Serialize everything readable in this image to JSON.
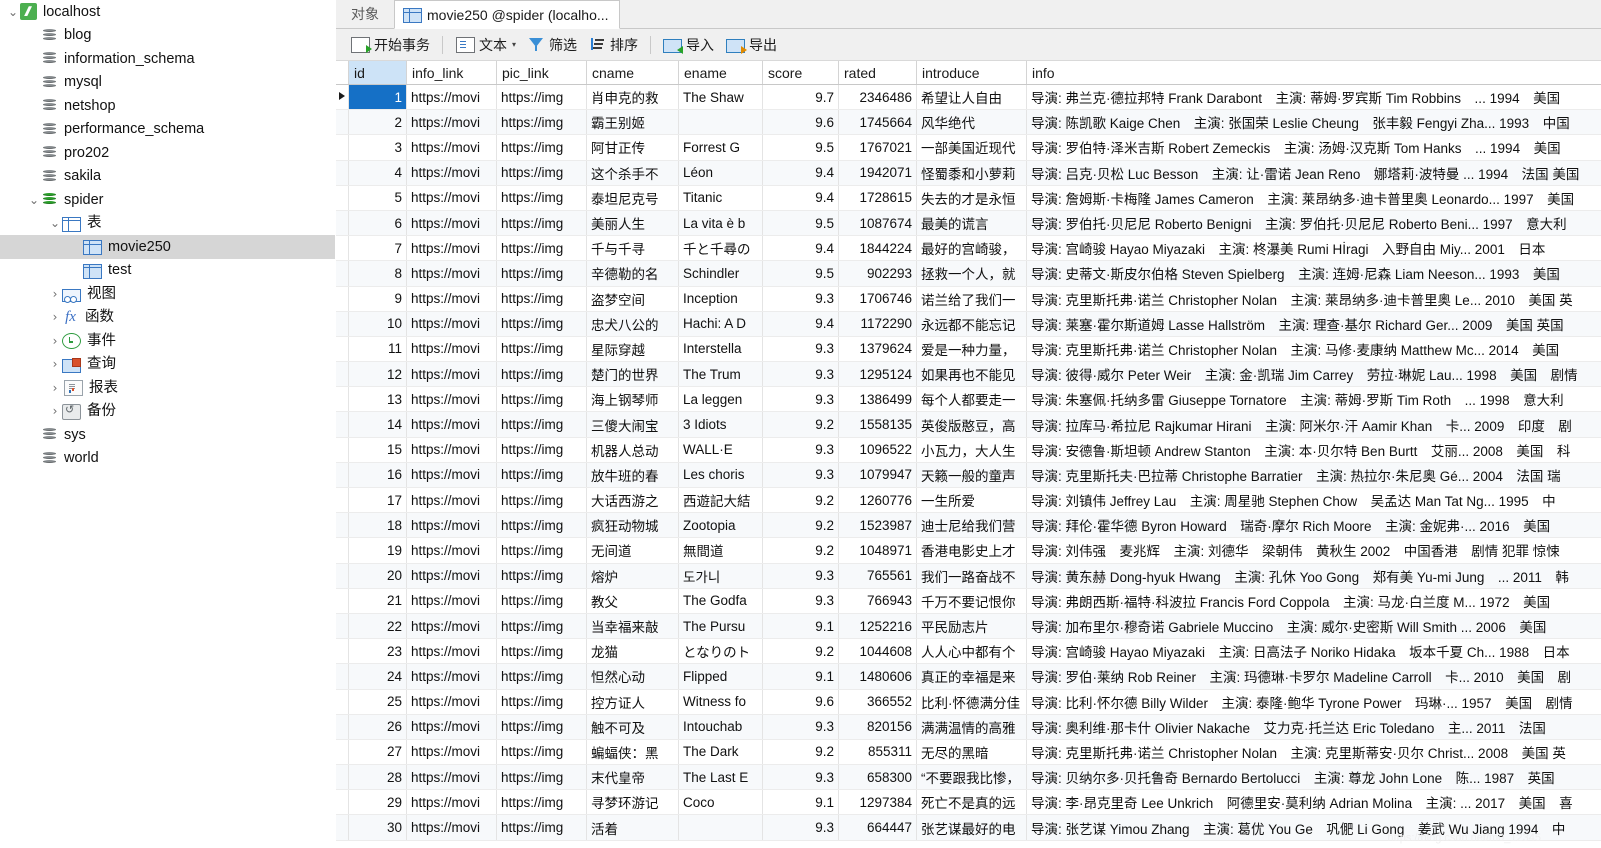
{
  "sidebar": {
    "items": [
      {
        "label": "localhost",
        "icon": "host-icon",
        "indent": 0,
        "twisty": "⌄",
        "selected": false
      },
      {
        "label": "blog",
        "icon": "database-icon",
        "indent": 1,
        "twisty": "",
        "selected": false
      },
      {
        "label": "information_schema",
        "icon": "database-icon",
        "indent": 1,
        "twisty": "",
        "selected": false
      },
      {
        "label": "mysql",
        "icon": "database-icon",
        "indent": 1,
        "twisty": "",
        "selected": false
      },
      {
        "label": "netshop",
        "icon": "database-icon",
        "indent": 1,
        "twisty": "",
        "selected": false
      },
      {
        "label": "performance_schema",
        "icon": "database-icon",
        "indent": 1,
        "twisty": "",
        "selected": false
      },
      {
        "label": "pro202",
        "icon": "database-icon",
        "indent": 1,
        "twisty": "",
        "selected": false
      },
      {
        "label": "sakila",
        "icon": "database-icon",
        "indent": 1,
        "twisty": "",
        "selected": false
      },
      {
        "label": "spider",
        "icon": "database-icon-green",
        "indent": 1,
        "twisty": "⌄",
        "selected": false
      },
      {
        "label": "表",
        "icon": "table-icon",
        "indent": 2,
        "twisty": "⌄",
        "selected": false
      },
      {
        "label": "movie250",
        "icon": "table-icon-filled",
        "indent": 3,
        "twisty": "",
        "selected": true
      },
      {
        "label": "test",
        "icon": "table-icon-filled",
        "indent": 3,
        "twisty": "",
        "selected": false
      },
      {
        "label": "视图",
        "icon": "view-icon",
        "indent": 2,
        "twisty": "›",
        "selected": false
      },
      {
        "label": "函数",
        "icon": "function-icon",
        "indent": 2,
        "twisty": "›",
        "selected": false
      },
      {
        "label": "事件",
        "icon": "event-clock-icon",
        "indent": 2,
        "twisty": "›",
        "selected": false
      },
      {
        "label": "查询",
        "icon": "query-icon",
        "indent": 2,
        "twisty": "›",
        "selected": false
      },
      {
        "label": "报表",
        "icon": "report-icon",
        "indent": 2,
        "twisty": "›",
        "selected": false
      },
      {
        "label": "备份",
        "icon": "backup-icon",
        "indent": 2,
        "twisty": "›",
        "selected": false
      },
      {
        "label": "sys",
        "icon": "database-icon",
        "indent": 1,
        "twisty": "",
        "selected": false
      },
      {
        "label": "world",
        "icon": "database-icon",
        "indent": 1,
        "twisty": "",
        "selected": false
      }
    ]
  },
  "tabs": [
    {
      "label": "对象",
      "icon": "",
      "active": false
    },
    {
      "label": "movie250 @spider (localho...",
      "icon": "table-icon",
      "active": true
    }
  ],
  "toolbar": {
    "begin_transaction": "开始事务",
    "text": "文本",
    "text_caret": "▾",
    "filter": "筛选",
    "sort": "排序",
    "import": "导入",
    "export": "导出"
  },
  "grid": {
    "columns": [
      {
        "key": "id",
        "label": "id",
        "selected": true
      },
      {
        "key": "info_link",
        "label": "info_link",
        "selected": false
      },
      {
        "key": "pic_link",
        "label": "pic_link",
        "selected": false
      },
      {
        "key": "cname",
        "label": "cname",
        "selected": false
      },
      {
        "key": "ename",
        "label": "ename",
        "selected": false
      },
      {
        "key": "score",
        "label": "score",
        "selected": false
      },
      {
        "key": "rated",
        "label": "rated",
        "selected": false
      },
      {
        "key": "introduce",
        "label": "introduce",
        "selected": false
      },
      {
        "key": "info",
        "label": "info",
        "selected": false
      }
    ],
    "current_row": 1,
    "rows": [
      {
        "id": "1",
        "info_link": "https://movi",
        "pic_link": "https://img",
        "cname": "肖申克的救",
        "ename": "The Shaw",
        "score": "9.7",
        "rated": "2346486",
        "introduce": "希望让人自由",
        "info": "导演: 弗兰克·德拉邦特 Frank Darabont　主演: 蒂姆·罗宾斯 Tim Robbins　... 1994　美国"
      },
      {
        "id": "2",
        "info_link": "https://movi",
        "pic_link": "https://img",
        "cname": "霸王别姬",
        "ename": "",
        "score": "9.6",
        "rated": "1745664",
        "introduce": "风华绝代",
        "info": "导演: 陈凯歌 Kaige Chen　主演: 张国荣 Leslie Cheung　张丰毅 Fengyi Zha... 1993　中国"
      },
      {
        "id": "3",
        "info_link": "https://movi",
        "pic_link": "https://img",
        "cname": "阿甘正传",
        "ename": "Forrest G",
        "score": "9.5",
        "rated": "1767021",
        "introduce": "一部美国近现代",
        "info": "导演: 罗伯特·泽米吉斯 Robert Zemeckis　主演: 汤姆·汉克斯 Tom Hanks　... 1994　美国"
      },
      {
        "id": "4",
        "info_link": "https://movi",
        "pic_link": "https://img",
        "cname": "这个杀手不",
        "ename": "Léon",
        "score": "9.4",
        "rated": "1942071",
        "introduce": "怪蜀黍和小萝莉",
        "info": "导演: 吕克·贝松 Luc Besson　主演: 让·雷诺 Jean Reno　娜塔莉·波特曼 ... 1994　法国 美国"
      },
      {
        "id": "5",
        "info_link": "https://movi",
        "pic_link": "https://img",
        "cname": "泰坦尼克号",
        "ename": "Titanic",
        "score": "9.4",
        "rated": "1728615",
        "introduce": "失去的才是永恒",
        "info": "导演: 詹姆斯·卡梅隆 James Cameron　主演: 莱昂纳多·迪卡普里奥 Leonardo... 1997　美国"
      },
      {
        "id": "6",
        "info_link": "https://movi",
        "pic_link": "https://img",
        "cname": "美丽人生",
        "ename": "La vita è b",
        "score": "9.5",
        "rated": "1087674",
        "introduce": "最美的谎言",
        "info": "导演: 罗伯托·贝尼尼 Roberto Benigni　主演: 罗伯托·贝尼尼 Roberto Beni... 1997　意大利"
      },
      {
        "id": "7",
        "info_link": "https://movi",
        "pic_link": "https://img",
        "cname": "千与千寻",
        "ename": "千と千尋の",
        "score": "9.4",
        "rated": "1844224",
        "introduce": "最好的宫崎骏，",
        "info": "导演: 宫崎骏 Hayao Miyazaki　主演: 柊瀑美 Rumi Hİragi　入野自由 Miy... 2001　日本"
      },
      {
        "id": "8",
        "info_link": "https://movi",
        "pic_link": "https://img",
        "cname": "辛德勒的名",
        "ename": "Schindler",
        "score": "9.5",
        "rated": "902293",
        "introduce": "拯救一个人，就",
        "info": "导演: 史蒂文·斯皮尔伯格 Steven Spielberg　主演: 连姆·尼森 Liam Neeson... 1993　美国"
      },
      {
        "id": "9",
        "info_link": "https://movi",
        "pic_link": "https://img",
        "cname": "盗梦空间",
        "ename": "Inception",
        "score": "9.3",
        "rated": "1706746",
        "introduce": "诺兰给了我们一",
        "info": "导演: 克里斯托弗·诺兰 Christopher Nolan　主演: 莱昂纳多·迪卡普里奥 Le... 2010　美国 英"
      },
      {
        "id": "10",
        "info_link": "https://movi",
        "pic_link": "https://img",
        "cname": "忠犬八公的",
        "ename": "Hachi: A D",
        "score": "9.4",
        "rated": "1172290",
        "introduce": "永远都不能忘记",
        "info": "导演: 莱塞·霍尔斯道姆 Lasse Hallström　主演: 理查·基尔 Richard Ger... 2009　美国 英国"
      },
      {
        "id": "11",
        "info_link": "https://movi",
        "pic_link": "https://img",
        "cname": "星际穿越",
        "ename": "Interstella",
        "score": "9.3",
        "rated": "1379624",
        "introduce": "爱是一种力量，",
        "info": "导演: 克里斯托弗·诺兰 Christopher Nolan　主演: 马修·麦康纳 Matthew Mc... 2014　美国"
      },
      {
        "id": "12",
        "info_link": "https://movi",
        "pic_link": "https://img",
        "cname": "楚门的世界",
        "ename": "The Trum",
        "score": "9.3",
        "rated": "1295124",
        "introduce": "如果再也不能见",
        "info": "导演: 彼得·威尔 Peter Weir　主演: 金·凯瑞 Jim Carrey　劳拉·琳妮 Lau... 1998　美国　剧情"
      },
      {
        "id": "13",
        "info_link": "https://movi",
        "pic_link": "https://img",
        "cname": "海上钢琴师",
        "ename": "La leggen",
        "score": "9.3",
        "rated": "1386499",
        "introduce": "每个人都要走一",
        "info": "导演: 朱塞佩·托纳多雷 Giuseppe Tornatore　主演: 蒂姆·罗斯 Tim Roth　... 1998　意大利"
      },
      {
        "id": "14",
        "info_link": "https://movi",
        "pic_link": "https://img",
        "cname": "三傻大闹宝",
        "ename": "3 Idiots",
        "score": "9.2",
        "rated": "1558135",
        "introduce": "英俊版憨豆，高",
        "info": "导演: 拉库马·希拉尼 Rajkumar Hirani　主演: 阿米尔·汗 Aamir Khan　卡... 2009　印度　剧"
      },
      {
        "id": "15",
        "info_link": "https://movi",
        "pic_link": "https://img",
        "cname": "机器人总动",
        "ename": "WALL·E",
        "score": "9.3",
        "rated": "1096522",
        "introduce": "小瓦力，大人生",
        "info": "导演: 安德鲁·斯坦顿 Andrew Stanton　主演: 本·贝尔特 Ben Burtt　艾丽... 2008　美国　科"
      },
      {
        "id": "16",
        "info_link": "https://movi",
        "pic_link": "https://img",
        "cname": "放牛班的春",
        "ename": "Les choris",
        "score": "9.3",
        "rated": "1079947",
        "introduce": "天籁一般的童声",
        "info": "导演: 克里斯托夫·巴拉蒂 Christophe Barratier　主演: 热拉尔·朱尼奥 Gé... 2004　法国 瑞"
      },
      {
        "id": "17",
        "info_link": "https://movi",
        "pic_link": "https://img",
        "cname": "大话西游之",
        "ename": "西遊記大結",
        "score": "9.2",
        "rated": "1260776",
        "introduce": "一生所爱",
        "info": "导演: 刘镇伟 Jeffrey Lau　主演: 周星驰 Stephen Chow　吴孟达 Man Tat Ng... 1995　中"
      },
      {
        "id": "18",
        "info_link": "https://movi",
        "pic_link": "https://img",
        "cname": "疯狂动物城",
        "ename": "Zootopia",
        "score": "9.2",
        "rated": "1523987",
        "introduce": "迪士尼给我们营",
        "info": "导演: 拜伦·霍华德 Byron Howard　瑞奇·摩尔 Rich Moore　主演: 金妮弗·... 2016　美国"
      },
      {
        "id": "19",
        "info_link": "https://movi",
        "pic_link": "https://img",
        "cname": "无间道",
        "ename": "無間道",
        "score": "9.2",
        "rated": "1048971",
        "introduce": "香港电影史上才",
        "info": "导演: 刘伟强　麦兆辉　主演: 刘德华　梁朝伟　黄秋生 2002　中国香港　剧情 犯罪 惊悚"
      },
      {
        "id": "20",
        "info_link": "https://movi",
        "pic_link": "https://img",
        "cname": "熔炉",
        "ename": "도가니",
        "score": "9.3",
        "rated": "765561",
        "introduce": "我们一路奋战不",
        "info": "导演: 黄东赫 Dong-hyuk Hwang　主演: 孔休 Yoo Gong　郑有美 Yu-mi Jung　... 2011　韩"
      },
      {
        "id": "21",
        "info_link": "https://movi",
        "pic_link": "https://img",
        "cname": "教父",
        "ename": "The Godfa",
        "score": "9.3",
        "rated": "766943",
        "introduce": "千万不要记恨你",
        "info": "导演: 弗朗西斯·福特·科波拉 Francis Ford Coppola　主演: 马龙·白兰度 M... 1972　美国"
      },
      {
        "id": "22",
        "info_link": "https://movi",
        "pic_link": "https://img",
        "cname": "当幸福来敲",
        "ename": "The Pursu",
        "score": "9.1",
        "rated": "1252216",
        "introduce": "平民励志片",
        "info": "导演: 加布里尔·穆奇诺 Gabriele Muccino　主演: 威尔·史密斯 Will Smith ... 2006　美国"
      },
      {
        "id": "23",
        "info_link": "https://movi",
        "pic_link": "https://img",
        "cname": "龙猫",
        "ename": "となりのト",
        "score": "9.2",
        "rated": "1044608",
        "introduce": "人人心中都有个",
        "info": "导演: 宫崎骏 Hayao Miyazaki　主演: 日高法子 Noriko Hidaka　坂本千夏 Ch... 1988　日本"
      },
      {
        "id": "24",
        "info_link": "https://movi",
        "pic_link": "https://img",
        "cname": "怛然心动",
        "ename": "Flipped",
        "score": "9.1",
        "rated": "1480606",
        "introduce": "真正的幸福是来",
        "info": "导演: 罗伯·莱纳 Rob Reiner　主演: 玛德琳·卡罗尔 Madeline Carroll　卡... 2010　美国　剧"
      },
      {
        "id": "25",
        "info_link": "https://movi",
        "pic_link": "https://img",
        "cname": "控方证人",
        "ename": "Witness fo",
        "score": "9.6",
        "rated": "366552",
        "introduce": "比利·怀德满分佳",
        "info": "导演: 比利·怀尔德 Billy Wilder　主演: 泰隆·鲍华 Tyrone Power　玛琳·... 1957　美国　剧情"
      },
      {
        "id": "26",
        "info_link": "https://movi",
        "pic_link": "https://img",
        "cname": "触不可及",
        "ename": "Intouchab",
        "score": "9.3",
        "rated": "820156",
        "introduce": "满满温情的高雅",
        "info": "导演: 奥利维·那卡什 Olivier Nakache　艾力克·托兰达 Eric Toledano　主... 2011　法国"
      },
      {
        "id": "27",
        "info_link": "https://movi",
        "pic_link": "https://img",
        "cname": "蝙蝠侠：黑",
        "ename": "The Dark",
        "score": "9.2",
        "rated": "855311",
        "introduce": "无尽的黑暗",
        "info": "导演: 克里斯托弗·诺兰 Christopher Nolan　主演: 克里斯蒂安·贝尔 Christ... 2008　美国 英"
      },
      {
        "id": "28",
        "info_link": "https://movi",
        "pic_link": "https://img",
        "cname": "末代皇帝",
        "ename": "The Last E",
        "score": "9.3",
        "rated": "658300",
        "introduce": "“不要跟我比惨，",
        "info": "导演: 贝纳尔多·贝托鲁奇 Bernardo Bertolucci　主演: 尊龙 John Lone　陈... 1987　英国"
      },
      {
        "id": "29",
        "info_link": "https://movi",
        "pic_link": "https://img",
        "cname": "寻梦环游记",
        "ename": "Coco",
        "score": "9.1",
        "rated": "1297384",
        "introduce": "死亡不是真的远",
        "info": "导演: 李·昂克里奇 Lee Unkrich　阿德里安·莫利纳 Adrian Molina　主演: ... 2017　美国　喜"
      },
      {
        "id": "30",
        "info_link": "https://movi",
        "pic_link": "https://img",
        "cname": "活着",
        "ename": "",
        "score": "9.3",
        "rated": "664447",
        "introduce": "张艺谋最好的电",
        "info": "导演: 张艺谋 Yimou Zhang　主演: 葛优 You Ge　巩俷 Li Gong　姜武 Wu Jiang 1994　中"
      }
    ]
  },
  "colors": {
    "selection_blue": "#1570c6",
    "header_selected": "#cde3f7",
    "sidebar_selected": "#d6d6d6",
    "toolbar_bg": "#f0f0f0"
  }
}
